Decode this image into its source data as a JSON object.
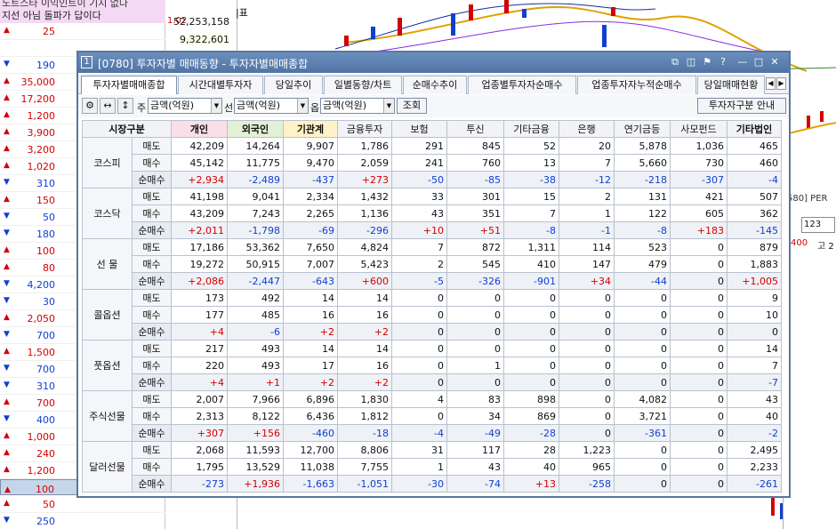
{
  "bg_left": {
    "header_line1": "노트스타 이익인트이 기지 없다",
    "header_line2": "지선 아님 돌파가 답이다",
    "rows": [
      {
        "dir": "up",
        "value": "25"
      },
      {
        "dir": "none",
        "value": ""
      },
      {
        "dir": "down",
        "value": "190"
      },
      {
        "dir": "up",
        "value": "35,000"
      },
      {
        "dir": "up",
        "value": "17,200"
      },
      {
        "dir": "up",
        "value": "1,200"
      },
      {
        "dir": "up",
        "value": "3,900"
      },
      {
        "dir": "up",
        "value": "3,200"
      },
      {
        "dir": "up",
        "value": "1,020"
      },
      {
        "dir": "down",
        "value": "310"
      },
      {
        "dir": "up",
        "value": "150"
      },
      {
        "dir": "down",
        "value": "50"
      },
      {
        "dir": "down",
        "value": "180"
      },
      {
        "dir": "up",
        "value": "100"
      },
      {
        "dir": "up",
        "value": "80"
      },
      {
        "dir": "down",
        "value": "4,200"
      },
      {
        "dir": "down",
        "value": "30"
      },
      {
        "dir": "up",
        "value": "2,050"
      },
      {
        "dir": "down",
        "value": "700"
      },
      {
        "dir": "up",
        "value": "1,500"
      },
      {
        "dir": "down",
        "value": "700"
      },
      {
        "dir": "down",
        "value": "310"
      },
      {
        "dir": "up",
        "value": "700"
      },
      {
        "dir": "down",
        "value": "400"
      },
      {
        "dir": "up",
        "value": "1,000"
      },
      {
        "dir": "up",
        "value": "240"
      },
      {
        "dir": "up",
        "value": "1,200"
      },
      {
        "dir": "up",
        "value": "100"
      },
      {
        "dir": "up",
        "value": "50"
      },
      {
        "dir": "down",
        "value": "250"
      }
    ],
    "mid_rate": "1.02",
    "mid_val1": "52,253,158",
    "mid_val2": "9,322,601",
    "right_label": "|표",
    "r2_text": "580] PER",
    "r2_box": "123",
    "r2_a": "400",
    "r2_b": "고 2"
  },
  "window": {
    "num": "1",
    "title": "[0780] 투자자별 매매동향 - 투자자별매매종합",
    "tabs": [
      "투자자별매매종합",
      "시간대별투자자",
      "당일추이",
      "일별동향/차트",
      "순매수추이",
      "업종별투자자순매수",
      "업종투자자누적순매수",
      "당일매매현황"
    ],
    "toolbar": {
      "label_ju": "주",
      "sel1": "금액(억원)",
      "label_seon": "선",
      "sel2": "금액(억원)",
      "label_ok": "옵",
      "sel3": "금액(억원)",
      "query": "조회",
      "guide": "투자자구분 안내"
    },
    "headers": [
      "시장구분",
      "개인",
      "외국인",
      "기관계",
      "금융투자",
      "보험",
      "투신",
      "기타금융",
      "은행",
      "연기금등",
      "사모펀드",
      "기타법인"
    ],
    "sub_labels": [
      "매도",
      "매수",
      "순매수"
    ],
    "groups": [
      {
        "name": "코스피",
        "rows": [
          [
            "42,209",
            "14,264",
            "9,907",
            "1,786",
            "291",
            "845",
            "52",
            "20",
            "5,878",
            "1,036",
            "465"
          ],
          [
            "45,142",
            "11,775",
            "9,470",
            "2,059",
            "241",
            "760",
            "13",
            "7",
            "5,660",
            "730",
            "460"
          ],
          [
            "+2,934",
            "-2,489",
            "-437",
            "+273",
            "-50",
            "-85",
            "-38",
            "-12",
            "-218",
            "-307",
            "-4"
          ]
        ]
      },
      {
        "name": "코스닥",
        "rows": [
          [
            "41,198",
            "9,041",
            "2,334",
            "1,432",
            "33",
            "301",
            "15",
            "2",
            "131",
            "421",
            "507"
          ],
          [
            "43,209",
            "7,243",
            "2,265",
            "1,136",
            "43",
            "351",
            "7",
            "1",
            "122",
            "605",
            "362"
          ],
          [
            "+2,011",
            "-1,798",
            "-69",
            "-296",
            "+10",
            "+51",
            "-8",
            "-1",
            "-8",
            "+183",
            "-145"
          ]
        ]
      },
      {
        "name": "선  물",
        "rows": [
          [
            "17,186",
            "53,362",
            "7,650",
            "4,824",
            "7",
            "872",
            "1,311",
            "114",
            "523",
            "0",
            "879"
          ],
          [
            "19,272",
            "50,915",
            "7,007",
            "5,423",
            "2",
            "545",
            "410",
            "147",
            "479",
            "0",
            "1,883"
          ],
          [
            "+2,086",
            "-2,447",
            "-643",
            "+600",
            "-5",
            "-326",
            "-901",
            "+34",
            "-44",
            "0",
            "+1,005"
          ]
        ]
      },
      {
        "name": "콜옵션",
        "rows": [
          [
            "173",
            "492",
            "14",
            "14",
            "0",
            "0",
            "0",
            "0",
            "0",
            "0",
            "9"
          ],
          [
            "177",
            "485",
            "16",
            "16",
            "0",
            "0",
            "0",
            "0",
            "0",
            "0",
            "10"
          ],
          [
            "+4",
            "-6",
            "+2",
            "+2",
            "0",
            "0",
            "0",
            "0",
            "0",
            "0",
            "0"
          ]
        ]
      },
      {
        "name": "풋옵션",
        "rows": [
          [
            "217",
            "493",
            "14",
            "14",
            "0",
            "0",
            "0",
            "0",
            "0",
            "0",
            "14"
          ],
          [
            "220",
            "493",
            "17",
            "16",
            "0",
            "1",
            "0",
            "0",
            "0",
            "0",
            "7"
          ],
          [
            "+4",
            "+1",
            "+2",
            "+2",
            "0",
            "0",
            "0",
            "0",
            "0",
            "0",
            "-7"
          ]
        ]
      },
      {
        "name": "주식선물",
        "rows": [
          [
            "2,007",
            "7,966",
            "6,896",
            "1,830",
            "4",
            "83",
            "898",
            "0",
            "4,082",
            "0",
            "43"
          ],
          [
            "2,313",
            "8,122",
            "6,436",
            "1,812",
            "0",
            "34",
            "869",
            "0",
            "3,721",
            "0",
            "40"
          ],
          [
            "+307",
            "+156",
            "-460",
            "-18",
            "-4",
            "-49",
            "-28",
            "0",
            "-361",
            "0",
            "-2"
          ]
        ]
      },
      {
        "name": "달러선물",
        "rows": [
          [
            "2,068",
            "11,593",
            "12,700",
            "8,806",
            "31",
            "117",
            "28",
            "1,223",
            "0",
            "0",
            "2,495"
          ],
          [
            "1,795",
            "13,529",
            "11,038",
            "7,755",
            "1",
            "43",
            "40",
            "965",
            "0",
            "0",
            "2,233"
          ],
          [
            "-273",
            "+1,936",
            "-1,663",
            "-1,051",
            "-30",
            "-74",
            "+13",
            "-258",
            "0",
            "0",
            "-261"
          ]
        ]
      }
    ]
  }
}
